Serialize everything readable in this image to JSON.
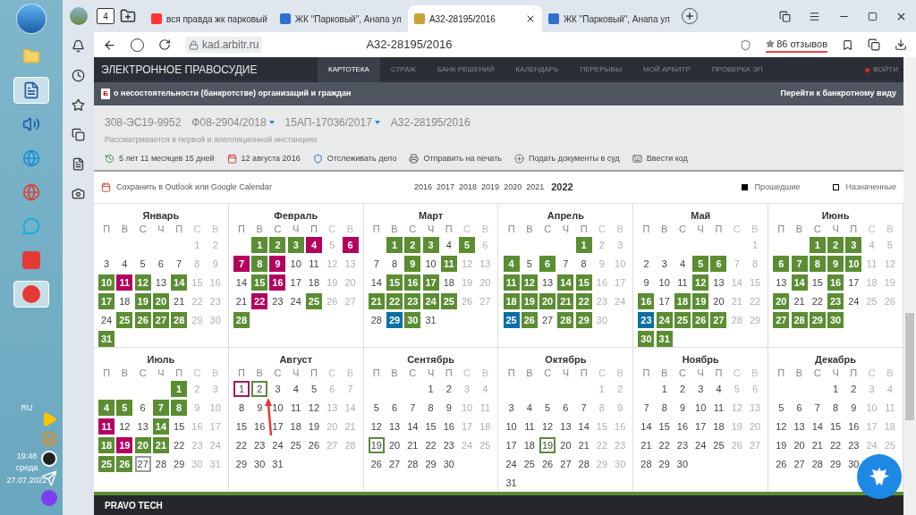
{
  "taskbar": {
    "language": "RU",
    "time": "19:48",
    "weekday": "среда",
    "date": "27.07.2022"
  },
  "browser": {
    "tab_count": "4",
    "tabs": [
      {
        "title": "вся правда жк парковый",
        "selected": false,
        "kind": "search"
      },
      {
        "title": "ЖК \"Парковый\", Анапа ул",
        "selected": false,
        "kind": "doc"
      },
      {
        "title": "А32-28195/2016",
        "selected": true,
        "kind": "emblem"
      },
      {
        "title": "ЖК \"Парковый\", Анапа ул",
        "selected": false,
        "kind": "doc"
      }
    ],
    "url": "kad.arbitr.ru",
    "page_title": "А32-28195/2016",
    "reviews": "86 отзывов"
  },
  "site": {
    "brand": "ЭЛЕКТРОННОЕ ПРАВОСУДИЕ",
    "nav": [
      {
        "label": "КАРТОТЕКА",
        "selected": true
      },
      {
        "label": "СТРАЖ",
        "selected": false
      },
      {
        "label": "БАНК РЕШЕНИЙ",
        "selected": false
      },
      {
        "label": "КАЛЕНДАРЬ",
        "selected": false
      },
      {
        "label": "ПЕРЕРЫВЫ",
        "selected": false
      },
      {
        "label": "МОЙ АРБИТР",
        "selected": false
      },
      {
        "label": "ПРОВЕРКА ЭП",
        "selected": false
      }
    ],
    "login": "ВОЙТИ"
  },
  "case": {
    "category_badge": "Б",
    "category": "о несостоятельности (банкротстве) организаций и граждан",
    "bankrupt_link": "Перейти к банкротному виду",
    "numbers": [
      {
        "text": "308-ЭС19-9952",
        "dropdown": false
      },
      {
        "text": "Ф08-2904/2018",
        "dropdown": true
      },
      {
        "text": "15АП-17036/2017",
        "dropdown": true
      },
      {
        "text": "А32-28195/2016",
        "dropdown": false
      }
    ],
    "status": "Рассматривается в первой и апелляционной инстанциях",
    "actions": [
      {
        "label": "5 лет 11 месяцев 15 дней",
        "kind": "duration"
      },
      {
        "label": "12 августа 2016",
        "kind": "date"
      },
      {
        "label": "Отслеживать дело",
        "kind": "track"
      },
      {
        "label": "Отправить на печать",
        "kind": "print"
      },
      {
        "label": "Подать документы в суд",
        "kind": "submit"
      },
      {
        "label": "Ввести код",
        "kind": "code"
      }
    ]
  },
  "calendar": {
    "export": "Сохранить в Outlook или Google Calendar",
    "years": [
      {
        "label": "2016",
        "selected": false
      },
      {
        "label": "2017",
        "selected": false
      },
      {
        "label": "2018",
        "selected": false
      },
      {
        "label": "2019",
        "selected": false
      },
      {
        "label": "2020",
        "selected": false
      },
      {
        "label": "2021",
        "selected": false
      },
      {
        "label": "2022",
        "selected": true
      }
    ],
    "legend": [
      {
        "label": "Прошедшие",
        "kind": "filled"
      },
      {
        "label": "Назначенные",
        "kind": "outline"
      }
    ],
    "months": [
      {
        "name": "Январь",
        "weekdays": [
          "П",
          "В",
          "С",
          "Ч",
          "П",
          "С",
          "В"
        ],
        "weeks": [
          [
            "1",
            "2"
          ],
          [
            "3",
            "4",
            "5",
            "6",
            "7",
            "8",
            "9"
          ],
          [
            {
              "d": "10",
              "kind": "past"
            },
            {
              "d": "11",
              "kind": "past_alt"
            },
            {
              "d": "12",
              "kind": "past"
            },
            "13",
            {
              "d": "14",
              "kind": "past"
            },
            "15",
            "16"
          ],
          [
            {
              "d": "17",
              "kind": "past"
            },
            "18",
            {
              "d": "19",
              "kind": "past"
            },
            {
              "d": "20",
              "kind": "past"
            },
            "21",
            "22",
            "23"
          ],
          [
            "24",
            {
              "d": "25",
              "kind": "past"
            },
            {
              "d": "26",
              "kind": "past"
            },
            {
              "d": "27",
              "kind": "past"
            },
            {
              "d": "28",
              "kind": "past"
            },
            "29",
            "30"
          ],
          [
            {
              "d": "31",
              "kind": "past"
            }
          ]
        ]
      },
      {
        "name": "Февраль",
        "weekdays": [
          "П",
          "В",
          "С",
          "Ч",
          "П",
          "С",
          "В"
        ],
        "weeks": [
          [
            {
              "d": "1",
              "kind": "past"
            },
            {
              "d": "2",
              "kind": "past"
            },
            {
              "d": "3",
              "kind": "past"
            },
            {
              "d": "4",
              "kind": "past_alt"
            },
            "5",
            {
              "d": "6",
              "kind": "past_alt"
            }
          ],
          [
            {
              "d": "7",
              "kind": "past_alt"
            },
            {
              "d": "8",
              "kind": "past"
            },
            {
              "d": "9",
              "kind": "past_alt"
            },
            "10",
            "11",
            "12",
            "13"
          ],
          [
            "14",
            {
              "d": "15",
              "kind": "past"
            },
            {
              "d": "16",
              "kind": "past_alt"
            },
            "17",
            "18",
            "19",
            "20"
          ],
          [
            "21",
            {
              "d": "22",
              "kind": "past_alt"
            },
            "23",
            "24",
            {
              "d": "25",
              "kind": "past"
            },
            "26",
            "27"
          ],
          [
            {
              "d": "28",
              "kind": "past"
            }
          ]
        ]
      },
      {
        "name": "Март",
        "weekdays": [
          "П",
          "В",
          "С",
          "Ч",
          "П",
          "С",
          "В"
        ],
        "weeks": [
          [
            {
              "d": "1",
              "kind": "past"
            },
            {
              "d": "2",
              "kind": "past"
            },
            {
              "d": "3",
              "kind": "past"
            },
            "4",
            {
              "d": "5",
              "kind": "past"
            },
            "6"
          ],
          [
            "7",
            "8",
            {
              "d": "9",
              "kind": "past"
            },
            "10",
            {
              "d": "11",
              "kind": "past"
            },
            "12",
            "13"
          ],
          [
            "14",
            {
              "d": "15",
              "kind": "past"
            },
            {
              "d": "16",
              "kind": "past"
            },
            {
              "d": "17",
              "kind": "past"
            },
            "18",
            "19",
            "20"
          ],
          [
            {
              "d": "21",
              "kind": "past"
            },
            {
              "d": "22",
              "kind": "past"
            },
            {
              "d": "23",
              "kind": "past"
            },
            {
              "d": "24",
              "kind": "past"
            },
            {
              "d": "25",
              "kind": "past"
            },
            "26",
            "27"
          ],
          [
            "28",
            {
              "d": "29",
              "kind": "past_blue"
            },
            {
              "d": "30",
              "kind": "past"
            },
            "31"
          ]
        ]
      },
      {
        "name": "Апрель",
        "weekdays": [
          "П",
          "В",
          "С",
          "Ч",
          "П",
          "С",
          "В"
        ],
        "weeks": [
          [
            {
              "d": "1",
              "kind": "past"
            },
            "2",
            "3"
          ],
          [
            {
              "d": "4",
              "kind": "past"
            },
            "5",
            {
              "d": "6",
              "kind": "past"
            },
            "7",
            "8",
            "9",
            "10"
          ],
          [
            {
              "d": "11",
              "kind": "past"
            },
            {
              "d": "12",
              "kind": "past"
            },
            "13",
            {
              "d": "14",
              "kind": "past"
            },
            {
              "d": "15",
              "kind": "past"
            },
            "16",
            "17"
          ],
          [
            {
              "d": "18",
              "kind": "past"
            },
            {
              "d": "19",
              "kind": "past"
            },
            {
              "d": "20",
              "kind": "past"
            },
            {
              "d": "21",
              "kind": "past"
            },
            {
              "d": "22",
              "kind": "past"
            },
            "23",
            "24"
          ],
          [
            {
              "d": "25",
              "kind": "past_blue"
            },
            {
              "d": "26",
              "kind": "past"
            },
            "27",
            {
              "d": "28",
              "kind": "past"
            },
            {
              "d": "29",
              "kind": "past"
            },
            "30"
          ]
        ]
      },
      {
        "name": "Май",
        "weekdays": [
          "П",
          "В",
          "С",
          "Ч",
          "П",
          "С",
          "В"
        ],
        "weeks": [
          [
            "1"
          ],
          [
            "2",
            "3",
            "4",
            {
              "d": "5",
              "kind": "past"
            },
            {
              "d": "6",
              "kind": "past"
            },
            "7",
            "8"
          ],
          [
            "9",
            "10",
            "11",
            {
              "d": "12",
              "kind": "past"
            },
            "13",
            "14",
            "15"
          ],
          [
            {
              "d": "16",
              "kind": "past"
            },
            "17",
            {
              "d": "18",
              "kind": "past"
            },
            {
              "d": "19",
              "kind": "past"
            },
            "20",
            "21",
            "22"
          ],
          [
            {
              "d": "23",
              "kind": "past_blue"
            },
            {
              "d": "24",
              "kind": "past"
            },
            {
              "d": "25",
              "kind": "past"
            },
            {
              "d": "26",
              "kind": "past"
            },
            {
              "d": "27",
              "kind": "past"
            },
            "28",
            "29"
          ],
          [
            {
              "d": "30",
              "kind": "past"
            },
            {
              "d": "31",
              "kind": "past"
            }
          ]
        ]
      },
      {
        "name": "Июнь",
        "weekdays": [
          "П",
          "В",
          "С",
          "Ч",
          "П",
          "С",
          "В"
        ],
        "weeks": [
          [
            {
              "d": "1",
              "kind": "past"
            },
            {
              "d": "2",
              "kind": "past"
            },
            {
              "d": "3",
              "kind": "past"
            },
            "4",
            "5"
          ],
          [
            {
              "d": "6",
              "kind": "past"
            },
            {
              "d": "7",
              "kind": "past"
            },
            {
              "d": "8",
              "kind": "past"
            },
            {
              "d": "9",
              "kind": "past"
            },
            {
              "d": "10",
              "kind": "past"
            },
            "11",
            "12"
          ],
          [
            "13",
            {
              "d": "14",
              "kind": "past"
            },
            "15",
            {
              "d": "16",
              "kind": "past"
            },
            "17",
            "18",
            "19"
          ],
          [
            {
              "d": "20",
              "kind": "past"
            },
            "21",
            "22",
            {
              "d": "23",
              "kind": "past"
            },
            "24",
            "25",
            "26"
          ],
          [
            {
              "d": "27",
              "kind": "past"
            },
            {
              "d": "28",
              "kind": "past"
            },
            {
              "d": "29",
              "kind": "past"
            },
            {
              "d": "30",
              "kind": "past"
            }
          ]
        ]
      },
      {
        "name": "Июль",
        "weekdays": [
          "П",
          "В",
          "С",
          "Ч",
          "П",
          "С",
          "В"
        ],
        "weeks": [
          [
            {
              "d": "1",
              "kind": "past"
            },
            "2",
            "3"
          ],
          [
            {
              "d": "4",
              "kind": "past"
            },
            {
              "d": "5",
              "kind": "past"
            },
            "6",
            {
              "d": "7",
              "kind": "past"
            },
            {
              "d": "8",
              "kind": "past"
            },
            "9",
            "10"
          ],
          [
            {
              "d": "11",
              "kind": "past_alt"
            },
            "12",
            "13",
            {
              "d": "14",
              "kind": "past"
            },
            "15",
            "16",
            "17"
          ],
          [
            {
              "d": "18",
              "kind": "past"
            },
            {
              "d": "19",
              "kind": "past_alt"
            },
            {
              "d": "20",
              "kind": "past"
            },
            {
              "d": "21",
              "kind": "past"
            },
            "22",
            "23",
            "24"
          ],
          [
            {
              "d": "25",
              "kind": "past"
            },
            {
              "d": "26",
              "kind": "past"
            },
            {
              "d": "27",
              "kind": "today"
            },
            "28",
            "29",
            "30",
            "31"
          ]
        ]
      },
      {
        "name": "Август",
        "weekdays": [
          "П",
          "В",
          "С",
          "Ч",
          "П",
          "С",
          "В"
        ],
        "weeks": [
          [
            {
              "d": "1",
              "kind": "planned_alt"
            },
            {
              "d": "2",
              "kind": "planned"
            },
            "3",
            "4",
            "5",
            "6",
            "7"
          ],
          [
            "8",
            "9",
            "10",
            "11",
            "12",
            "13",
            "14"
          ],
          [
            "15",
            "16",
            "17",
            "18",
            "19",
            "20",
            "21"
          ],
          [
            "22",
            "23",
            "24",
            "25",
            "26",
            "27",
            "28"
          ],
          [
            "29",
            "30",
            "31"
          ]
        ]
      },
      {
        "name": "Сентябрь",
        "weekdays": [
          "П",
          "В",
          "С",
          "Ч",
          "П",
          "С",
          "В"
        ],
        "weeks": [
          [
            "1",
            "2",
            "3",
            "4"
          ],
          [
            "5",
            "6",
            "7",
            "8",
            "9",
            "10",
            "11"
          ],
          [
            "12",
            "13",
            "14",
            "15",
            "16",
            "17",
            "18"
          ],
          [
            {
              "d": "19",
              "kind": "planned"
            },
            "20",
            "21",
            "22",
            "23",
            "24",
            "25"
          ],
          [
            "26",
            "27",
            "28",
            "29",
            "30"
          ]
        ]
      },
      {
        "name": "Октябрь",
        "weekdays": [
          "П",
          "В",
          "С",
          "Ч",
          "П",
          "С",
          "В"
        ],
        "weeks": [
          [
            "1",
            "2"
          ],
          [
            "3",
            "4",
            "5",
            "6",
            "7",
            "8",
            "9"
          ],
          [
            "10",
            "11",
            "12",
            "13",
            "14",
            "15",
            "16"
          ],
          [
            "17",
            "18",
            {
              "d": "19",
              "kind": "planned"
            },
            "20",
            "21",
            "22",
            "23"
          ],
          [
            "24",
            "25",
            "26",
            "27",
            "28",
            "29",
            "30"
          ],
          [
            "31"
          ]
        ]
      },
      {
        "name": "Ноябрь",
        "weekdays": [
          "П",
          "В",
          "С",
          "Ч",
          "П",
          "С",
          "В"
        ],
        "weeks": [
          [
            "1",
            "2",
            "3",
            "4",
            "5",
            "6"
          ],
          [
            "7",
            "8",
            "9",
            "10",
            "11",
            "12",
            "13"
          ],
          [
            "14",
            "15",
            "16",
            "17",
            "18",
            "19",
            "20"
          ],
          [
            "21",
            "22",
            "23",
            "24",
            "25",
            "26",
            "27"
          ],
          [
            "28",
            "29",
            "30"
          ]
        ]
      },
      {
        "name": "Декабрь",
        "weekdays": [
          "П",
          "В",
          "С",
          "Ч",
          "П",
          "С",
          "В"
        ],
        "weeks": [
          [
            "1",
            "2",
            "3",
            "4"
          ],
          [
            "5",
            "6",
            "7",
            "8",
            "9",
            "10",
            "11"
          ],
          [
            "12",
            "13",
            "14",
            "15",
            "16",
            "17",
            "18"
          ],
          [
            "19",
            "20",
            "21",
            "22",
            "23",
            "24",
            "25"
          ],
          [
            "26",
            "27",
            "28",
            "29",
            "30"
          ]
        ]
      }
    ]
  },
  "footer": {
    "brand": "PRAVO TECH"
  }
}
